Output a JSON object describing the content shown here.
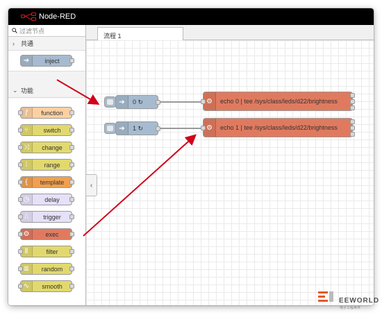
{
  "app": {
    "title": "Node-RED"
  },
  "palette": {
    "filter_placeholder": "过滤节点",
    "categories": [
      {
        "label": "共通",
        "chevron": "›",
        "nodes": [
          {
            "label": "inject",
            "color": "#a6bbcf"
          }
        ]
      },
      {
        "label": "功能",
        "chevron": "⌄",
        "nodes": [
          {
            "label": "function",
            "color": "#fdd0a2"
          },
          {
            "label": "switch",
            "color": "#e2d96e"
          },
          {
            "label": "change",
            "color": "#e2d96e"
          },
          {
            "label": "range",
            "color": "#e2d96e"
          },
          {
            "label": "template",
            "color": "#f0a04f"
          },
          {
            "label": "delay",
            "color": "#e6e0f8"
          },
          {
            "label": "trigger",
            "color": "#e6e0f8"
          },
          {
            "label": "exec",
            "color": "#e07a5f"
          },
          {
            "label": "filter",
            "color": "#e2d96e"
          },
          {
            "label": "random",
            "color": "#e2d96e"
          },
          {
            "label": "smooth",
            "color": "#e2d96e"
          }
        ]
      }
    ]
  },
  "tabs": [
    {
      "label": "流程 1"
    }
  ],
  "flow": {
    "inject_nodes": [
      {
        "label": "0 ↻"
      },
      {
        "label": "1 ↻"
      }
    ],
    "exec_nodes": [
      {
        "label": "echo 0 | tee /sys/class/leds/d22/brightness"
      },
      {
        "label": "echo 1 | tee /sys/class/leds/d22/brightness"
      }
    ],
    "colors": {
      "inject": "#a6bbcf",
      "exec": "#e07a5f",
      "wire": "#999999",
      "annotation": "#d0021b"
    }
  },
  "watermark": {
    "text": "EEWORLD",
    "sub": "电子工程世界"
  }
}
